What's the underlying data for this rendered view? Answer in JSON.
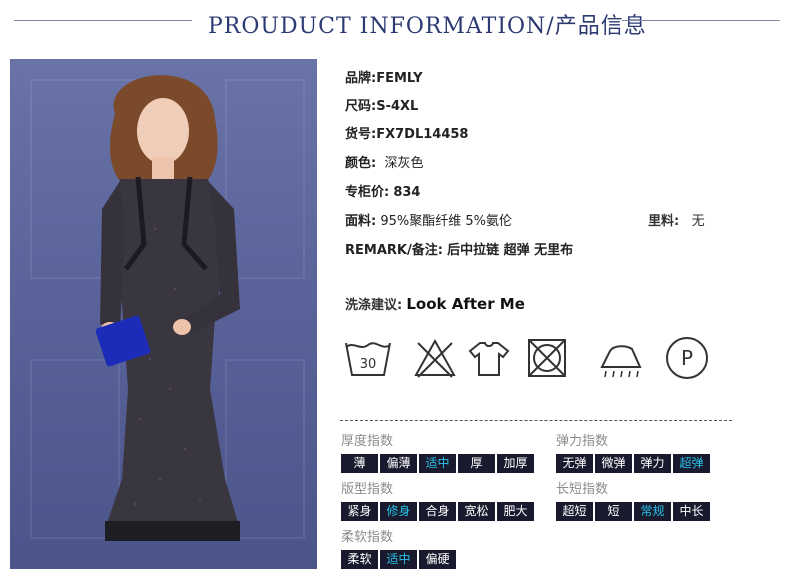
{
  "header": {
    "title": "PROUDUCT INFORMATION/产品信息"
  },
  "product": {
    "brand": {
      "label": "品牌:",
      "value": "FEMLY"
    },
    "size": {
      "label": "尺码:",
      "value": "S-4XL"
    },
    "item_no": {
      "label": "货号:",
      "value": "FX7DL14458"
    },
    "color": {
      "label": "颜色:",
      "value": "深灰色"
    },
    "price": {
      "label": "专柜价:",
      "value": "834"
    },
    "fabric": {
      "label": "面料:",
      "value": "95%聚酯纤维 5%氨伦"
    },
    "lining": {
      "label": "里料:",
      "value": "无"
    },
    "remark": {
      "label": "REMARK/备注:",
      "value": "后中拉链 超弹 无里布"
    }
  },
  "care": {
    "label": "洗涤建议:",
    "value": "Look After Me",
    "icons": [
      "wash-30-icon",
      "no-bleach-icon",
      "hang-dry-icon",
      "no-tumble-dry-icon",
      "iron-steam-icon",
      "dry-clean-p-icon"
    ],
    "wash_temp": "30",
    "dry_clean_letter": "P"
  },
  "indices": {
    "thickness": {
      "title": "厚度指数",
      "options": [
        "薄",
        "偏薄",
        "适中",
        "厚",
        "加厚"
      ],
      "selected": "适中"
    },
    "elasticity": {
      "title": "弹力指数",
      "options": [
        "无弹",
        "微弹",
        "弹力",
        "超弹"
      ],
      "selected": "超弹"
    },
    "fit": {
      "title": "版型指数",
      "options": [
        "紧身",
        "修身",
        "合身",
        "宽松",
        "肥大"
      ],
      "selected": "修身"
    },
    "length": {
      "title": "长短指数",
      "options": [
        "超短",
        "短",
        "常规",
        "中长"
      ],
      "selected": "常规"
    },
    "softness": {
      "title": "柔软指数",
      "options": [
        "柔软",
        "适中",
        "偏硬"
      ],
      "selected": "适中"
    }
  },
  "colors": {
    "title": "#2b3a72",
    "option_bg": "#1a1a2e",
    "option_selected": "#27c1e8",
    "index_title": "#8c8c8c"
  }
}
